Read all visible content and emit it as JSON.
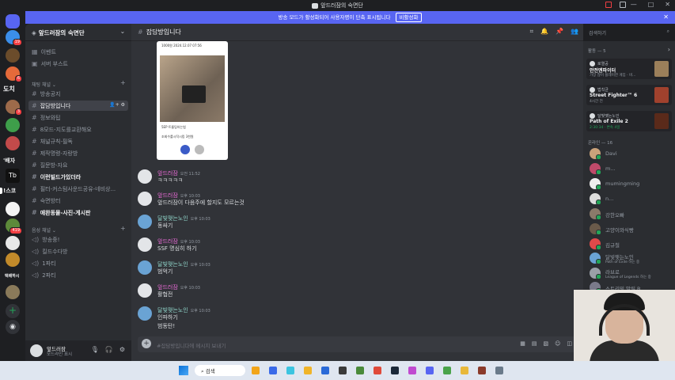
{
  "window": {
    "title": "앞드러잠의 숙면단",
    "controls": [
      "—",
      "□",
      "✕"
    ]
  },
  "banner": {
    "text": "방송 모드가 활성화되어 사용자명이 단축 표시됩니다",
    "button": "비활성화",
    "close": "✕"
  },
  "guilds": [
    {
      "badge": "19"
    },
    {
      "badge": ""
    },
    {
      "badge": "6"
    },
    {
      "text": "도치"
    },
    {
      "badge": "3"
    },
    {
      "badge": ""
    },
    {
      "badge": ""
    },
    {
      "text": "'배자"
    },
    {
      "text": "Tb"
    },
    {
      "text": "!스코"
    },
    {
      "badge": ""
    },
    {
      "badge": "419"
    },
    {
      "badge": ""
    },
    {
      "badge": ""
    },
    {
      "text": "택배하시"
    },
    {
      "badge": ""
    }
  ],
  "server": {
    "name": "앞드러잠의 숙면단",
    "top_items": [
      {
        "label": "이벤트",
        "icon": "calendar-icon"
      },
      {
        "label": "서버 부스트",
        "icon": "boost-icon"
      }
    ],
    "text_category": "채팅 채널",
    "channels": [
      {
        "label": "방송공지"
      },
      {
        "label": "잡담방입니다",
        "active": true
      },
      {
        "label": "정보와팁"
      },
      {
        "label": "8모드-지도를교환해요"
      },
      {
        "label": "채널규칙-필독"
      },
      {
        "label": "제작명령-자랑방"
      },
      {
        "label": "질문방-자요"
      },
      {
        "label": "이런빌드가있더라",
        "unread": true
      },
      {
        "label": "필터-커스텀사운드공유-네비상..."
      },
      {
        "label": "숙면방터"
      },
      {
        "label": "애완동물-사진-게시판",
        "unread": true
      }
    ],
    "voice_category": "음성 채널",
    "voice_channels": [
      {
        "label": "방송중!"
      },
      {
        "label": "킬드수다방"
      },
      {
        "label": "1파티"
      },
      {
        "label": "2파티"
      }
    ]
  },
  "user_panel": {
    "name": "앞드러잠",
    "status": "모드라인 표시"
  },
  "channel": {
    "name": "잡담방입니다",
    "composer_placeholder": "#잡담방입니다에 메시지 보내기"
  },
  "search": {
    "placeholder": "검색하기"
  },
  "embed": {
    "caption1": "5EP 트롬팅하는법",
    "caption2": "조회수를시작시킹 3천원",
    "header": "1000원 2024.12.07 07:56"
  },
  "messages": [
    {
      "author": "앞드러잠",
      "time": "오전 11:52",
      "color": "pink",
      "lines": [
        "ㅋㅋㅋㅋㅋ"
      ]
    },
    {
      "author": "앞드러잠",
      "time": "오후 10:03",
      "color": "pink",
      "lines": [
        "앞드러잠이 다음주에 할지도 모르는것"
      ]
    },
    {
      "author": "달빛맺는노인",
      "time": "오후 10:03",
      "color": "teal",
      "lines": [
        "동싸기"
      ]
    },
    {
      "author": "앞드러잠",
      "time": "오후 10:03",
      "color": "pink",
      "lines": [
        "SSF 명심히 하기"
      ]
    },
    {
      "author": "달빛맺는노인",
      "time": "오후 10:03",
      "color": "teal",
      "lines": [
        "범억기"
      ]
    },
    {
      "author": "앞드러잠",
      "time": "오후 10:03",
      "color": "pink",
      "lines": [
        "활협전"
      ]
    },
    {
      "author": "달빛맺는노인",
      "time": "오후 10:03",
      "color": "teal",
      "lines": [
        "인파하기",
        "범동탄!"
      ]
    }
  ],
  "members": {
    "activity_header": "활동 — 5",
    "activities": [
      {
        "who": "로열공",
        "game": "안전엔파이터",
        "sub": "가장 많이 플레이한 게임 · 비..."
      },
      {
        "who": "법칙균",
        "game": "Street Fighter™ 6",
        "sub": "4시간 전"
      },
      {
        "who": "달빛맺는노인",
        "game": "Path of Exile 2",
        "sub": "2:30:34 · 변속 4일"
      }
    ],
    "online_header": "온라인 — 16",
    "online": [
      {
        "name": "Davi"
      },
      {
        "name": "m..."
      },
      {
        "name": "mumingming"
      },
      {
        "name": "n..."
      },
      {
        "name": "강한오빠"
      },
      {
        "name": "고양이와식빵"
      },
      {
        "name": "김규철"
      },
      {
        "name": "달빛맺는노인",
        "status": "Path of Exile 하는 중"
      },
      {
        "name": "라브로",
        "status": "League of Legends 하는 중"
      },
      {
        "name": "스트리밍 말릴 B..."
      }
    ]
  },
  "taskbar": {
    "search": "검색"
  }
}
